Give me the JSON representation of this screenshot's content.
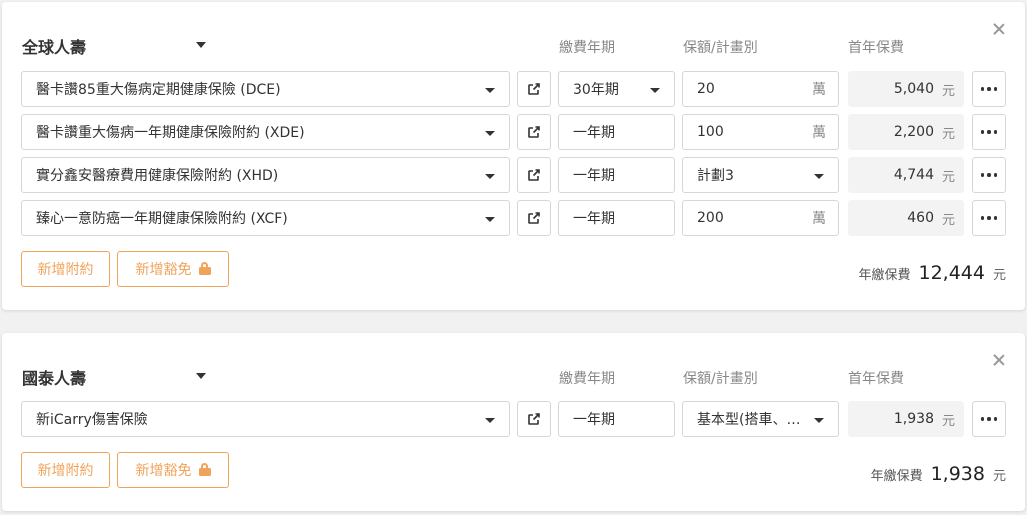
{
  "labels": {
    "period_header": "繳費年期",
    "amount_header": "保額/計畫別",
    "premium_header": "首年保費",
    "currency": "元",
    "wan_unit": "萬",
    "add_rider": "新增附約",
    "add_waiver": "新增豁免",
    "annual_total": "年繳保費"
  },
  "policies": [
    {
      "company": "全球人壽",
      "rows": [
        {
          "plan": "醫卡讚85重大傷病定期健康保險 (DCE)",
          "period": "30年期",
          "period_dropdown": true,
          "amount": "20",
          "amount_unit": "萬",
          "amount_dropdown": false,
          "premium": "5,040"
        },
        {
          "plan": "醫卡讚重大傷病一年期健康保險附約 (XDE)",
          "period": "一年期",
          "period_dropdown": false,
          "amount": "100",
          "amount_unit": "萬",
          "amount_dropdown": false,
          "premium": "2,200"
        },
        {
          "plan": "實分鑫安醫療費用健康保險附約 (XHD)",
          "period": "一年期",
          "period_dropdown": false,
          "amount": "計劃3",
          "amount_unit": "",
          "amount_dropdown": true,
          "premium": "4,744"
        },
        {
          "plan": "臻心一意防癌一年期健康保險附約 (XCF)",
          "period": "一年期",
          "period_dropdown": false,
          "amount": "200",
          "amount_unit": "萬",
          "amount_dropdown": false,
          "premium": "460"
        }
      ],
      "total": "12,444"
    },
    {
      "company": "國泰人壽",
      "rows": [
        {
          "plan": "新iCarry傷害保險",
          "period": "一年期",
          "period_dropdown": false,
          "amount": "基本型(搭車、…",
          "amount_unit": "",
          "amount_dropdown": true,
          "premium": "1,938"
        }
      ],
      "total": "1,938"
    }
  ],
  "colors": {
    "accent": "#f0a35b",
    "premium_bg": "#f3f3f3"
  },
  "icons": {
    "external": "external-link-icon",
    "more": "more-horizontal-icon",
    "lock": "lock-icon",
    "close": "close-icon"
  }
}
